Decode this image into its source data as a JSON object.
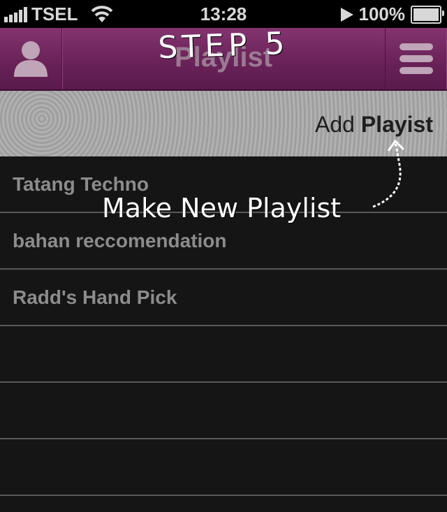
{
  "status_bar": {
    "carrier": "TSEL",
    "time": "13:28",
    "battery": "100%"
  },
  "navbar": {
    "title": "Playlist",
    "left_icon": "user-icon",
    "right_icon": "menu-icon"
  },
  "toolbar": {
    "add_prefix": "Add",
    "add_bold": "Playist"
  },
  "playlists": [
    "Tatang Techno",
    "bahan reccomendation",
    "Radd's Hand Pick",
    "",
    "",
    ""
  ],
  "annotations": {
    "step": "STEP 5",
    "note": "Make New Playlist"
  },
  "colors": {
    "navbar": "#6a2259",
    "toolbar": "#a8a8a8",
    "list_bg": "#151515"
  }
}
